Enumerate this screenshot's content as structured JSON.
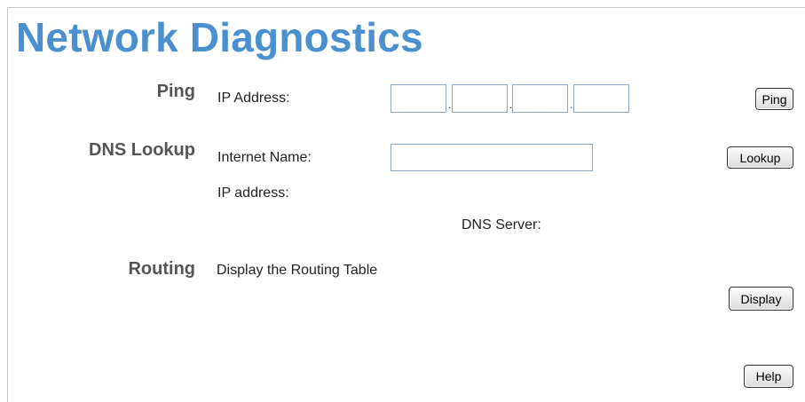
{
  "page": {
    "title": "Network Diagnostics"
  },
  "ping": {
    "section_label": "Ping",
    "ip_label": "IP Address:",
    "octets": [
      "",
      "",
      "",
      ""
    ],
    "separator": ".",
    "button_label": "Ping"
  },
  "dns": {
    "section_label": "DNS Lookup",
    "name_label": "Internet Name:",
    "name_value": "",
    "ip_label": "IP address:",
    "server_label": "DNS Server:",
    "button_label": "Lookup"
  },
  "routing": {
    "section_label": "Routing",
    "description": "Display the Routing Table",
    "button_label": "Display"
  },
  "help": {
    "button_label": "Help"
  }
}
